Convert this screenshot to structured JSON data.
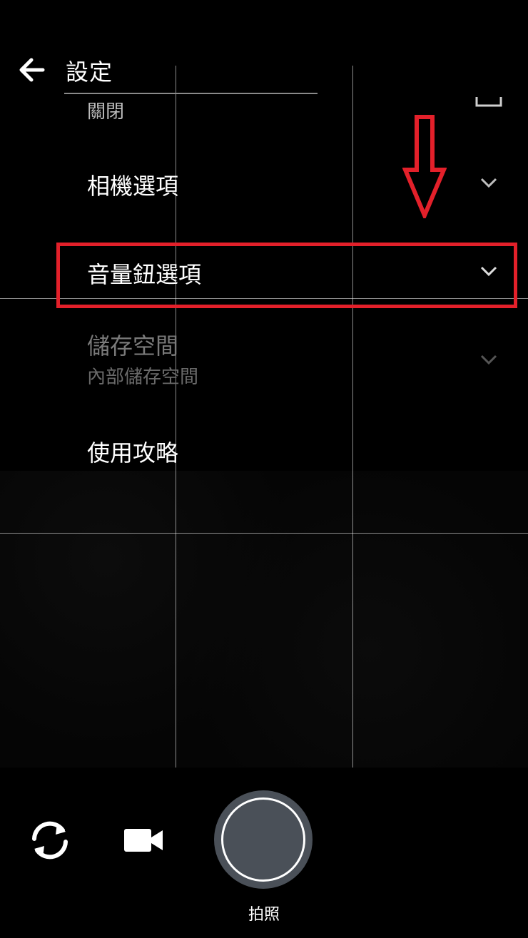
{
  "header": {
    "title": "設定"
  },
  "settings": {
    "top_value": "關閉",
    "items": [
      {
        "label": "相機選項",
        "sublabel": ""
      },
      {
        "label": "音量鈕選項",
        "sublabel": ""
      },
      {
        "label": "儲存空間",
        "sublabel": "內部儲存空間"
      },
      {
        "label": "使用攻略",
        "sublabel": ""
      }
    ]
  },
  "shutter": {
    "label": "拍照"
  },
  "colors": {
    "highlight": "#e3202a",
    "background": "#000000",
    "shutter": "#4a5058"
  },
  "icons": [
    "back-arrow-icon",
    "chevron-down-icon",
    "switch-camera-icon",
    "video-camera-icon",
    "down-arrow-annotation-icon"
  ]
}
